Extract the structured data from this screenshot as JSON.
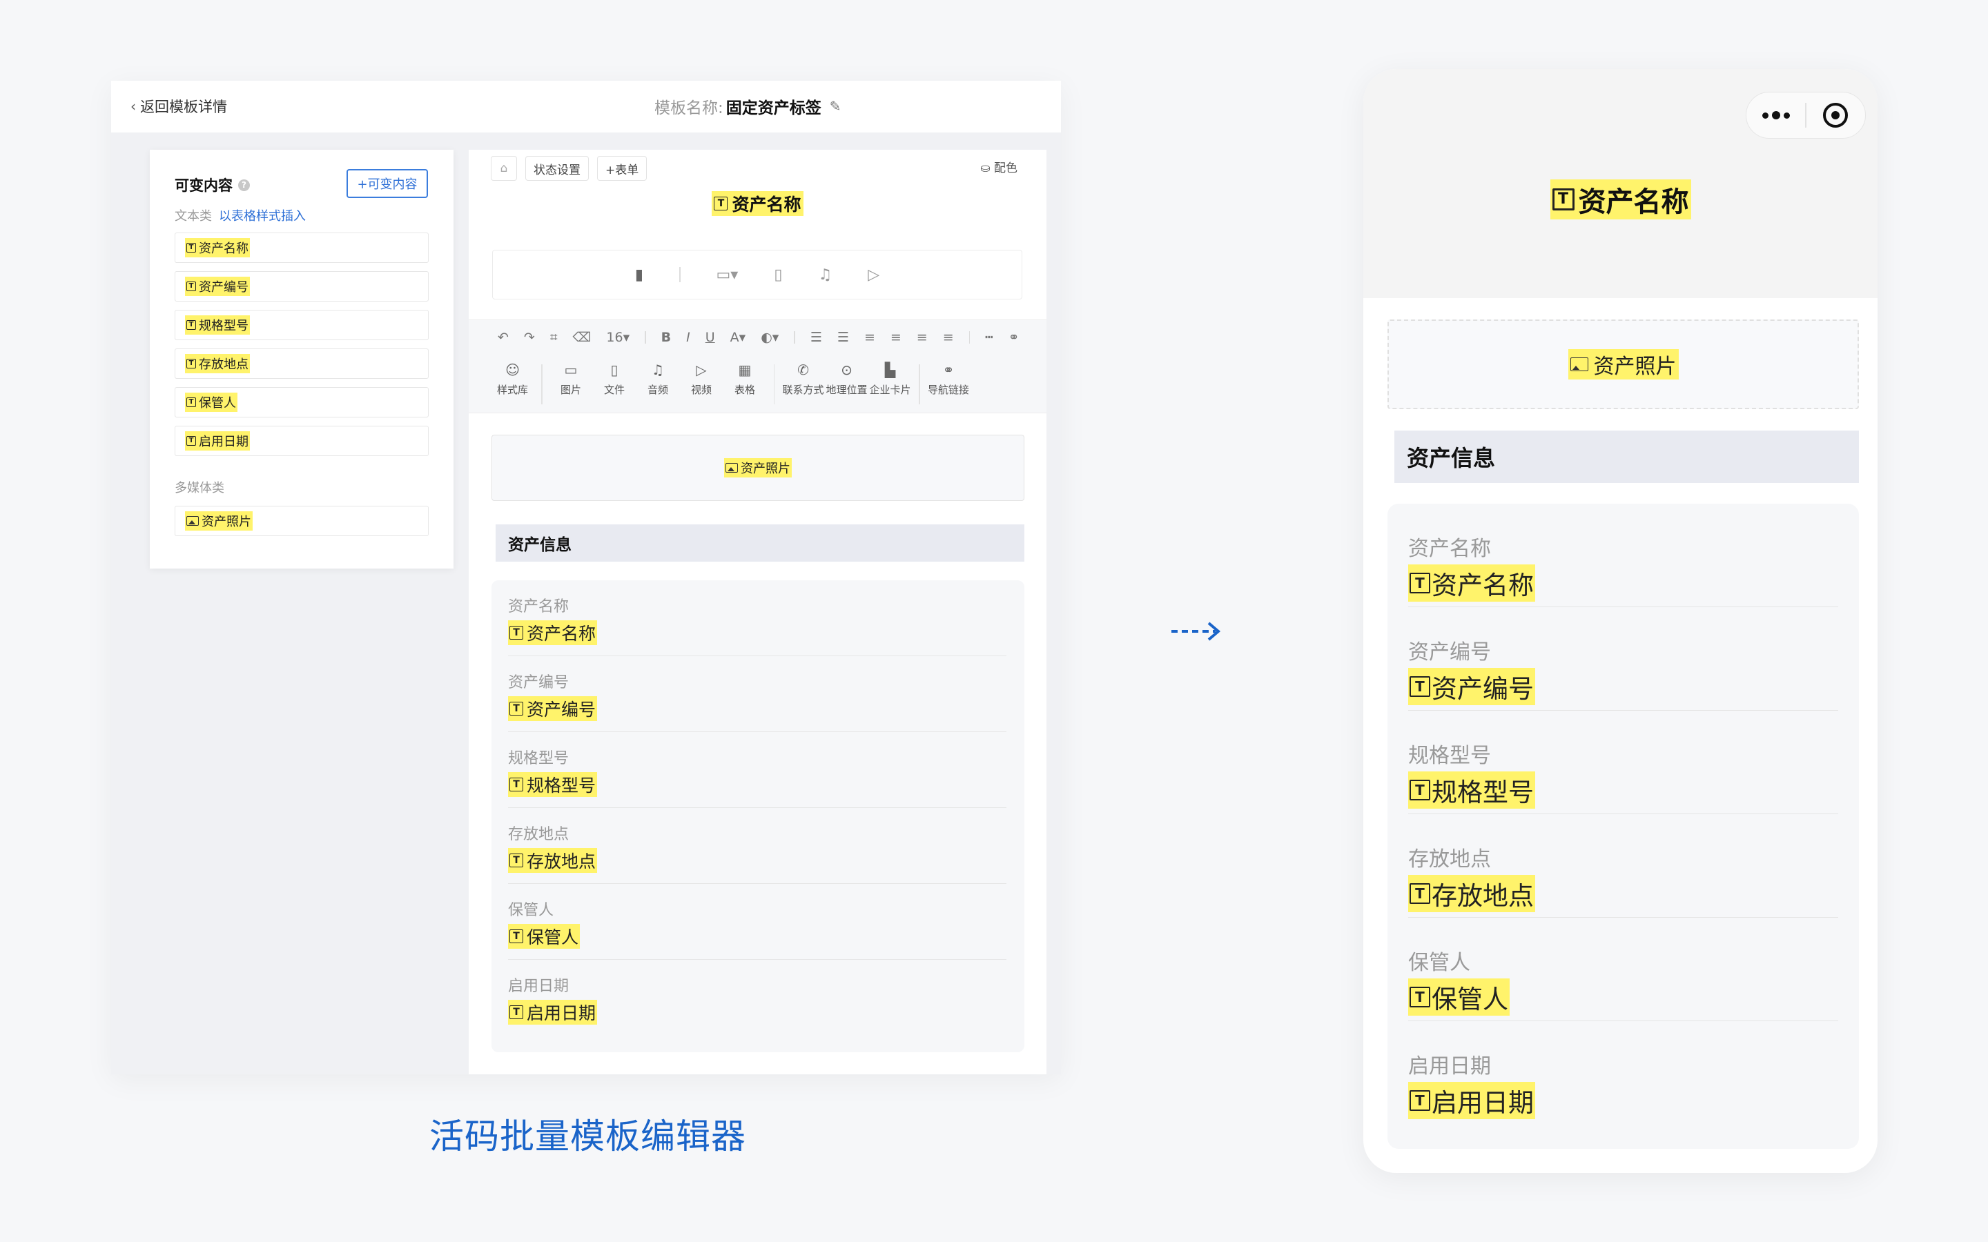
{
  "editor": {
    "back_label": "返回模板详情",
    "template_name_label": "模板名称:",
    "template_name_value": "固定资产标签",
    "sidebar": {
      "title": "可变内容",
      "add_button": "+可变内容",
      "text_group_label": "文本类",
      "insert_table_link": "以表格样式插入",
      "text_items": [
        "资产名称",
        "资产编号",
        "规格型号",
        "存放地点",
        "保管人",
        "启用日期"
      ],
      "media_group_label": "多媒体类",
      "media_items": [
        "资产照片"
      ]
    },
    "canvas": {
      "status_button": "状态设置",
      "form_button": "+表单",
      "color_button": "配色",
      "title_chip": "资产名称",
      "font_size": "16",
      "tools": [
        {
          "label": "样式库",
          "icon": "palette-icon"
        },
        {
          "label": "图片",
          "icon": "image-icon"
        },
        {
          "label": "文件",
          "icon": "file-icon"
        },
        {
          "label": "音频",
          "icon": "music-icon"
        },
        {
          "label": "视频",
          "icon": "video-icon"
        },
        {
          "label": "表格",
          "icon": "table-icon"
        },
        {
          "label": "联系方式",
          "icon": "phone-icon"
        },
        {
          "label": "地理位置",
          "icon": "location-icon"
        },
        {
          "label": "企业卡片",
          "icon": "building-icon"
        },
        {
          "label": "导航链接",
          "icon": "link-icon"
        }
      ],
      "photo_chip": "资产照片",
      "section_title": "资产信息",
      "fields": [
        {
          "label": "资产名称",
          "value": "资产名称"
        },
        {
          "label": "资产编号",
          "value": "资产编号"
        },
        {
          "label": "规格型号",
          "value": "规格型号"
        },
        {
          "label": "存放地点",
          "value": "存放地点"
        },
        {
          "label": "保管人",
          "value": "保管人"
        },
        {
          "label": "启用日期",
          "value": "启用日期"
        }
      ]
    },
    "caption": "活码批量模板编辑器"
  },
  "phone": {
    "title_chip": "资产名称",
    "photo_chip": "资产照片",
    "section_title": "资产信息",
    "fields": [
      {
        "label": "资产名称",
        "value": "资产名称"
      },
      {
        "label": "资产编号",
        "value": "资产编号"
      },
      {
        "label": "规格型号",
        "value": "规格型号"
      },
      {
        "label": "存放地点",
        "value": "存放地点"
      },
      {
        "label": "保管人",
        "value": "保管人"
      },
      {
        "label": "启用日期",
        "value": "启用日期"
      }
    ]
  },
  "colors": {
    "highlight": "#fff36b",
    "accent_blue": "#2d6fd6",
    "caption_blue": "#1a64c9",
    "section_bg": "#e8eaf1"
  }
}
